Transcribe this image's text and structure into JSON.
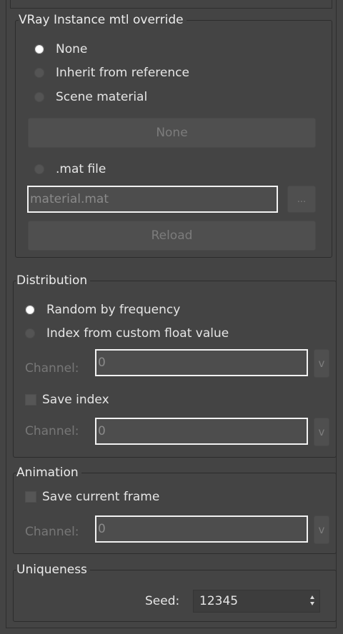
{
  "override": {
    "title": "VRay Instance mtl override",
    "options": [
      "None",
      "Inherit from reference",
      "Scene material"
    ],
    "selected": "None",
    "material_button": "None",
    "mat_file_label": ".mat file",
    "mat_file_value": "material.mat",
    "browse_label": "...",
    "reload_label": "Reload"
  },
  "distribution": {
    "title": "Distribution",
    "options": [
      "Random by frequency",
      "Index from custom float value"
    ],
    "selected": "Random by frequency",
    "channel_label": "Channel:",
    "channel_value": "0",
    "v_label": "v",
    "save_index_label": "Save index",
    "save_index_checked": false,
    "save_channel_label": "Channel:",
    "save_channel_value": "0",
    "save_v_label": "v"
  },
  "animation": {
    "title": "Animation",
    "save_frame_label": "Save current frame",
    "save_frame_checked": false,
    "channel_label": "Channel:",
    "channel_value": "0",
    "v_label": "v"
  },
  "uniqueness": {
    "title": "Uniqueness",
    "seed_label": "Seed:",
    "seed_value": "12345"
  },
  "colors": {
    "panel_bg": "#444444",
    "highlight_border": "#f2f2f2",
    "disabled_text": "#7c7c7c"
  }
}
